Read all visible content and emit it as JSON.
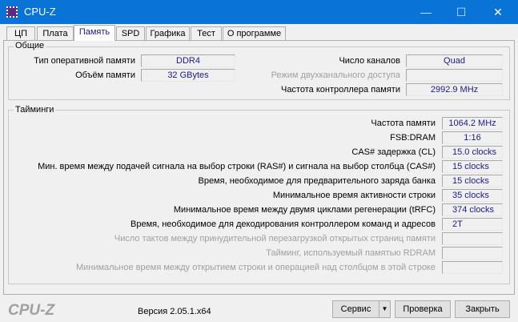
{
  "window": {
    "title": "CPU-Z",
    "minimize": "—",
    "maximize": "☐",
    "close": "✕"
  },
  "tabs": [
    {
      "label": "ЦП"
    },
    {
      "label": "Плата"
    },
    {
      "label": "Память"
    },
    {
      "label": "SPD"
    },
    {
      "label": "Графика"
    },
    {
      "label": "Тест"
    },
    {
      "label": "О программе"
    }
  ],
  "general": {
    "title": "Общие",
    "type_label": "Тип оперативной памяти",
    "type_value": "DDR4",
    "size_label": "Объём памяти",
    "size_value": "32 GBytes",
    "channels_label": "Число каналов",
    "channels_value": "Quad",
    "dc_label": "Режим двухканального доступа",
    "dc_value": "",
    "uncore_label": "Частота контроллера памяти",
    "uncore_value": "2992.9 MHz"
  },
  "timings": {
    "title": "Тайминги",
    "rows": [
      {
        "label": "Частота памяти",
        "value": "1064.2 MHz",
        "enabled": true
      },
      {
        "label": "FSB:DRAM",
        "value": "1:16",
        "enabled": true
      },
      {
        "label": "CAS# задержка (CL)",
        "value": "15.0 clocks",
        "enabled": true
      },
      {
        "label": "Мин. время между подачей сигнала на выбор строки (RAS#) и сигнала на выбор столбца (CAS#)",
        "value": "15 clocks",
        "enabled": true
      },
      {
        "label": "Время, необходимое для предварительного заряда банка",
        "value": "15 clocks",
        "enabled": true
      },
      {
        "label": "Минимальное время активности строки",
        "value": "35 clocks",
        "enabled": true
      },
      {
        "label": "Минимальное время между двумя циклами регенерации (tRFC)",
        "value": "374 clocks",
        "enabled": true
      },
      {
        "label": "Время, необходимое для декодирования контроллером команд и адресов",
        "value": "2T",
        "enabled": true
      },
      {
        "label": "Число тактов между принудительной перезагрузкой открытых страниц памяти",
        "value": "",
        "enabled": false
      },
      {
        "label": "Тайминг, используемый памятью RDRAM",
        "value": "",
        "enabled": false
      },
      {
        "label": "Минимальное время между открытием строки и операцией над столбцом в этой строке",
        "value": "",
        "enabled": false
      }
    ]
  },
  "footer": {
    "logo": "CPU-Z",
    "version": "Версия 2.05.1.x64",
    "tools": "Сервис",
    "tools_arrow": "▼",
    "validate": "Проверка",
    "close": "Закрыть"
  }
}
